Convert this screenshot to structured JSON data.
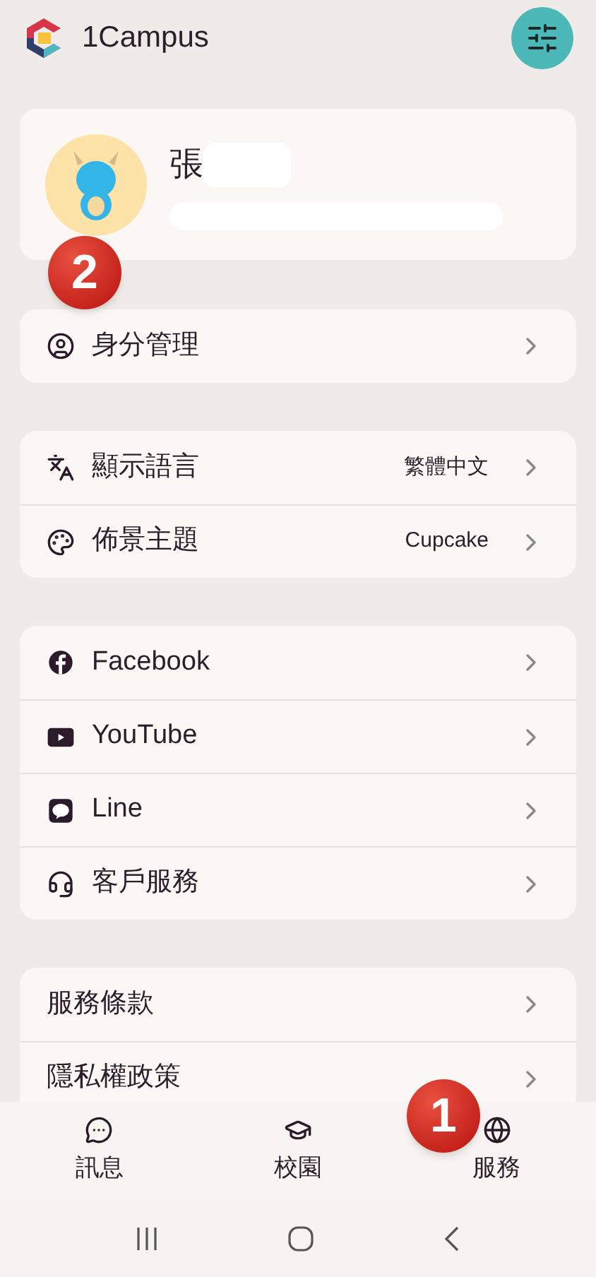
{
  "app": {
    "title": "1Campus"
  },
  "profile": {
    "name": "張"
  },
  "sections": [
    {
      "items": [
        {
          "label": "身分管理"
        }
      ]
    },
    {
      "items": [
        {
          "label": "顯示語言",
          "value": "繁體中文"
        },
        {
          "label": "佈景主題",
          "value": "Cupcake"
        }
      ]
    },
    {
      "items": [
        {
          "label": "Facebook"
        },
        {
          "label": "YouTube"
        },
        {
          "label": "Line"
        },
        {
          "label": "客戶服務"
        }
      ]
    },
    {
      "items": [
        {
          "label": "服務條款"
        },
        {
          "label": "隱私權政策"
        }
      ]
    }
  ],
  "bottom_nav": [
    {
      "label": "訊息"
    },
    {
      "label": "校園"
    },
    {
      "label": "服務"
    }
  ],
  "markers": [
    {
      "number": "2"
    },
    {
      "number": "1"
    }
  ]
}
